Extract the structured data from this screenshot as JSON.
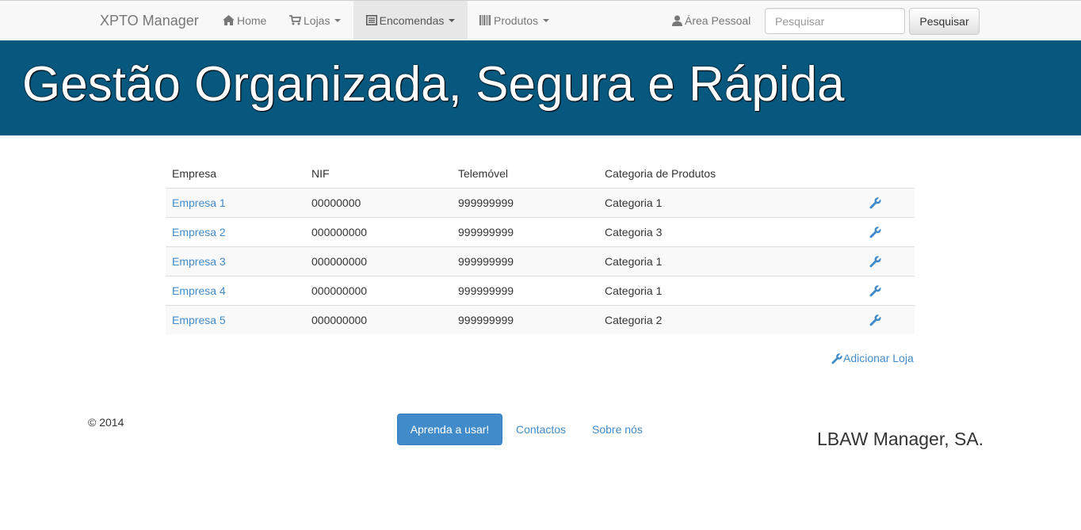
{
  "navbar": {
    "brand": "XPTO Manager",
    "items": [
      {
        "label": "Home",
        "icon": "home-icon"
      },
      {
        "label": "Lojas",
        "icon": "shopping-cart-icon"
      },
      {
        "label": "Encomendas",
        "icon": "list-alt-icon",
        "active": true
      },
      {
        "label": "Produtos",
        "icon": "barcode-icon"
      }
    ],
    "personal_area": "Área Pessoal",
    "search_placeholder": "Pesquisar",
    "search_button": "Pesquisar"
  },
  "hero": {
    "title": "Gestão Organizada, Segura e Rápida"
  },
  "table": {
    "headers": [
      "Empresa",
      "NIF",
      "Telemóvel",
      "Categoria de Produtos"
    ],
    "rows": [
      [
        "Empresa 1",
        "00000000",
        "999999999",
        "Categoria 1"
      ],
      [
        "Empresa 2",
        "000000000",
        "999999999",
        "Categoria 3"
      ],
      [
        "Empresa 3",
        "000000000",
        "999999999",
        "Categoria 1"
      ],
      [
        "Empresa 4",
        "000000000",
        "999999999",
        "Categoria 1"
      ],
      [
        "Empresa 5",
        "000000000",
        "999999999",
        "Categoria 2"
      ]
    ],
    "row_action_icon": "wrench-icon"
  },
  "add_store": "Adicionar Loja",
  "footer": {
    "copyright": "© 2014",
    "learn_button": "Aprenda a usar!",
    "contacts": "Contactos",
    "about": "Sobre nós",
    "company": "LBAW Manager, SA."
  },
  "colors": {
    "hero_bg": "#07587f",
    "link": "#428bca",
    "primary_button": "#428bca",
    "navbar_bg": "#f8f8f8"
  }
}
